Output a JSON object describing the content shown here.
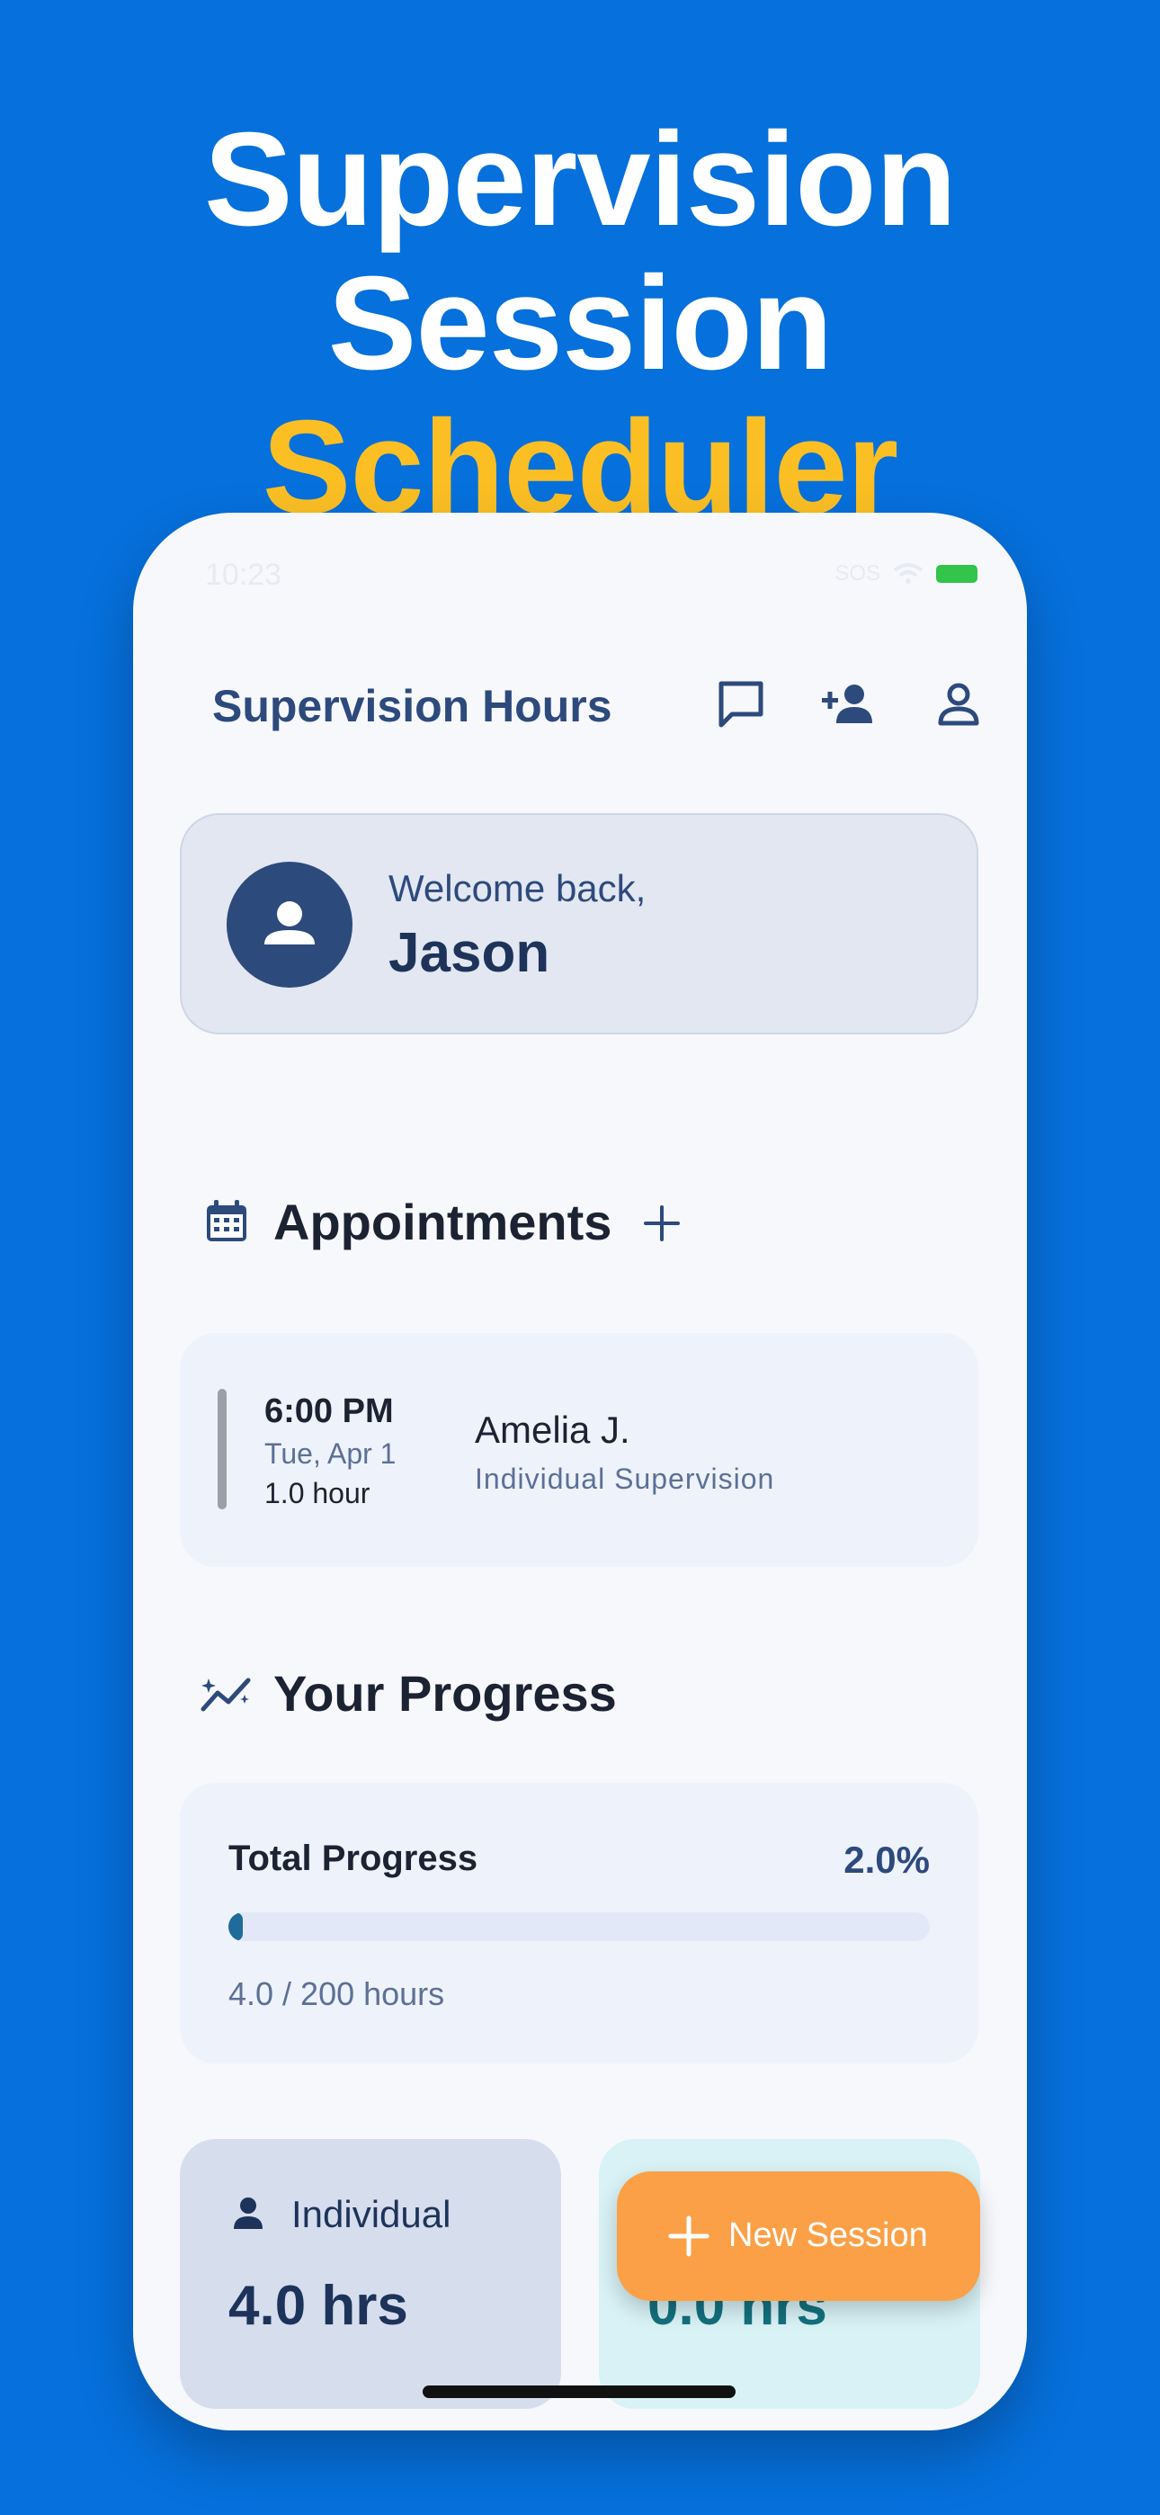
{
  "headline": {
    "line1": "Supervision",
    "line2_plain": "Session",
    "line2_accent": "Scheduler"
  },
  "status": {
    "time": "10:23",
    "carrier": "SOS"
  },
  "header": {
    "title": "Supervision Hours",
    "icons": [
      "chat-icon",
      "add-user-icon",
      "profile-icon"
    ]
  },
  "welcome": {
    "greeting": "Welcome back,",
    "name": "Jason"
  },
  "appointments": {
    "title": "Appointments",
    "items": [
      {
        "time": "6:00 PM",
        "date": "Tue, Apr 1",
        "duration": "1.0 hour",
        "name": "Amelia J.",
        "type": "Individual Supervision"
      }
    ]
  },
  "progress": {
    "title": "Your Progress",
    "total_label": "Total Progress",
    "percent_text": "2.0%",
    "fraction": 0.02,
    "hours_text": "4.0 / 200 hours"
  },
  "stats": {
    "individual": {
      "label": "Individual",
      "value": "4.0 hrs"
    },
    "group": {
      "value": "0.0 hrs"
    }
  },
  "fab": {
    "label": "New Session"
  },
  "colors": {
    "background": "#0670dc",
    "accent": "#fbbf24",
    "primary": "#2d4a7c",
    "fab": "#fba046"
  }
}
